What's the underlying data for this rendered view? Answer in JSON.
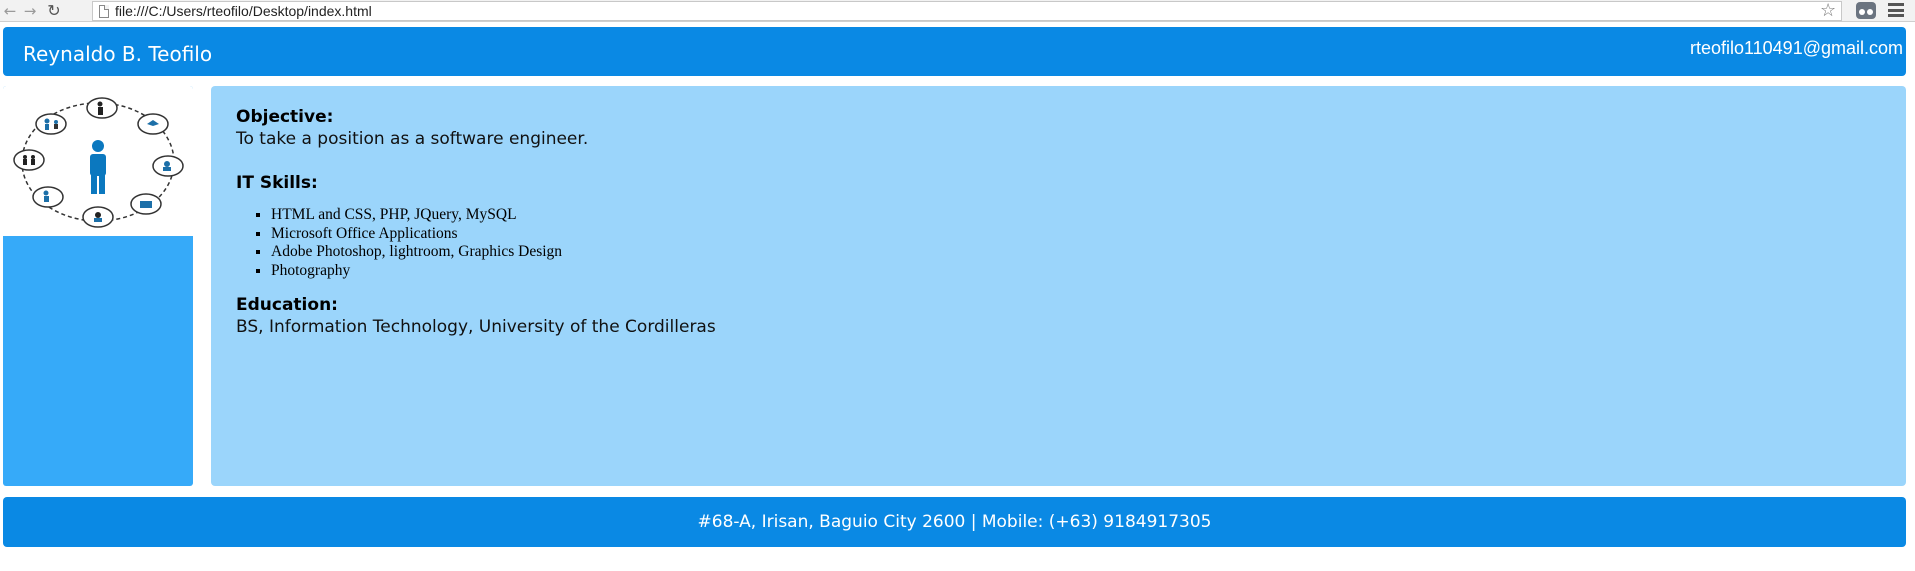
{
  "browser": {
    "url": "file:///C:/Users/rteofilo/Desktop/index.html"
  },
  "header": {
    "name": "Reynaldo B. Teofilo",
    "email": "rteofilo110491@gmail.com"
  },
  "sidebar": {
    "logo_icon": "people-network-icon"
  },
  "content": {
    "objective_heading": "Objective:",
    "objective_text": "To take a position as a software engineer.",
    "skills_heading": "IT Skills:",
    "skills": [
      "HTML and CSS, PHP, JQuery, MySQL",
      "Microsoft Office Applications",
      "Adobe Photoshop, lightroom, Graphics Design",
      "Photography"
    ],
    "education_heading": "Education:",
    "education_text": "BS, Information Technology, University of the Cordilleras"
  },
  "footer": {
    "address": "#68-A, Irisan, Baguio City 2600 | Mobile: (+63) 9184917305"
  },
  "colors": {
    "header_blue": "#0a89e4",
    "sidebar_blue": "#36aaf9",
    "content_blue": "#9bd5fb"
  }
}
